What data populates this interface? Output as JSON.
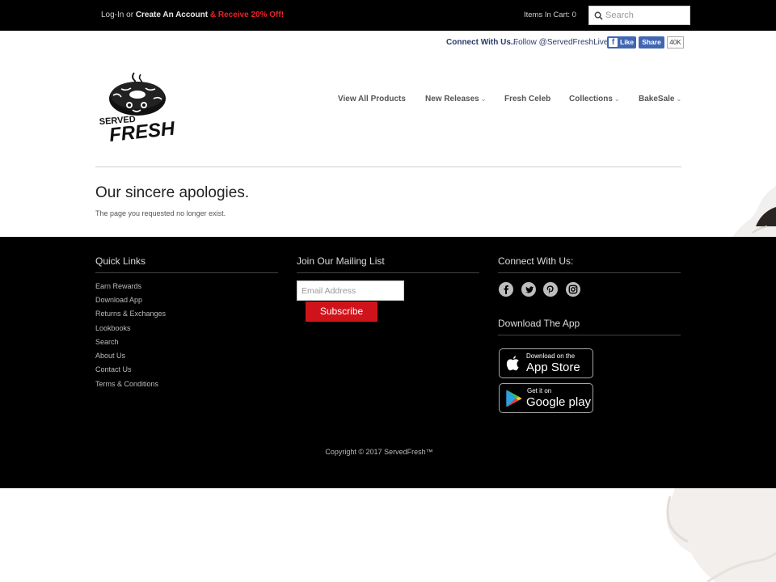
{
  "topbar": {
    "login_label": "Log-In",
    "or_text": " or ",
    "create_account_label": "Create An Account",
    "promo_text": " & Receive 20% Off!",
    "cart_label": "Items In Cart: 0",
    "search_placeholder": "Search"
  },
  "social_bar": {
    "connect_label": "Connect With Us...",
    "follow_label": "Follow @ServedFreshLive",
    "like_label": "Like",
    "share_label": "Share",
    "count": "40K"
  },
  "logo": {
    "line1": "SERVED",
    "line2": "FRESH"
  },
  "nav": {
    "items": [
      {
        "label": "View All Products",
        "dropdown": false
      },
      {
        "label": "New Releases",
        "dropdown": true
      },
      {
        "label": "Fresh Celeb",
        "dropdown": false
      },
      {
        "label": "Collections",
        "dropdown": true
      },
      {
        "label": "BakeSale",
        "dropdown": true
      }
    ]
  },
  "main": {
    "title": "Our sincere apologies.",
    "message": "The page you requested no longer exist."
  },
  "footer": {
    "quick_links_title": "Quick Links",
    "quick_links": [
      "Earn Rewards",
      "Download App",
      "Returns & Exchanges",
      "Lookbooks",
      "Search",
      "About Us",
      "Contact Us",
      "Terms & Conditions"
    ],
    "mailing_title": "Join Our Mailing List",
    "email_placeholder": "Email Address",
    "subscribe_label": "Subscribe",
    "connect_title": "Connect With Us:",
    "social_icons": [
      "facebook-icon",
      "twitter-icon",
      "pinterest-icon",
      "instagram-icon"
    ],
    "app_title": "Download The App",
    "appstore_small": "Download on the",
    "appstore_big": "App Store",
    "googleplay_small": "Get it on",
    "googleplay_big": "Google play",
    "copyright": "Copyright © 2017 ServedFresh™"
  },
  "colors": {
    "topbar_bg": "#000000",
    "promo_red": "#e8232a",
    "subscribe_red": "#d0131b",
    "facebook_blue": "#4267b2",
    "footer_bg": "#000000"
  }
}
